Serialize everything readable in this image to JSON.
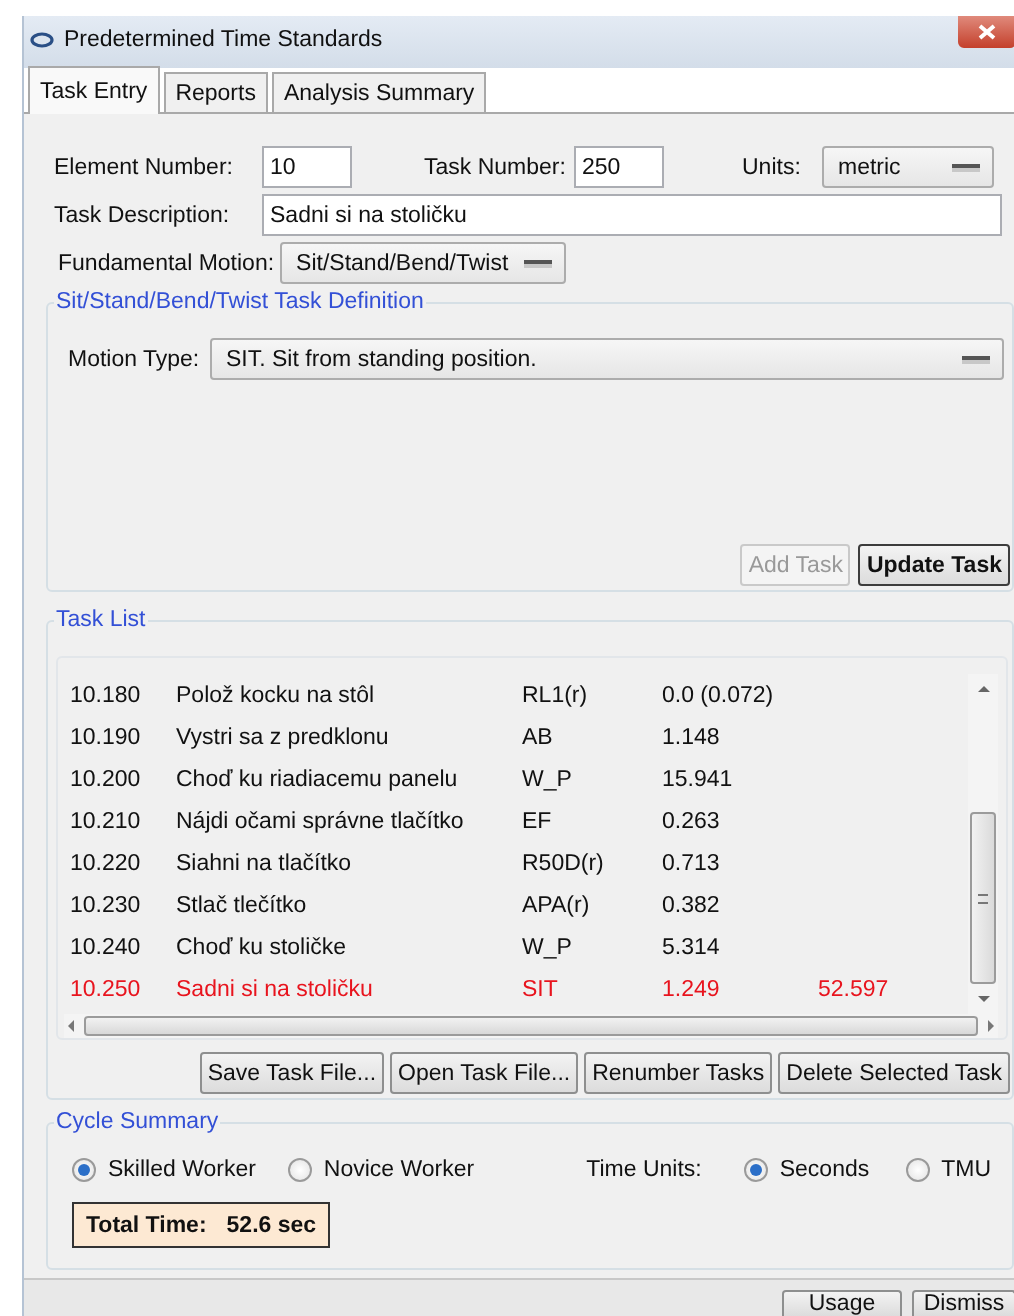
{
  "window": {
    "title": "Predetermined Time Standards"
  },
  "tabs": [
    {
      "label": "Task Entry",
      "selected": true
    },
    {
      "label": "Reports",
      "selected": false
    },
    {
      "label": "Analysis Summary",
      "selected": false
    }
  ],
  "task_entry": {
    "element_number": {
      "label": "Element Number:",
      "value": "10"
    },
    "task_number": {
      "label": "Task Number:",
      "value": "250"
    },
    "units": {
      "label": "Units:",
      "value": "metric"
    },
    "task_description": {
      "label": "Task Description:",
      "value": "Sadni si na stoličku"
    },
    "fundamental_motion": {
      "label": "Fundamental Motion:",
      "value": "Sit/Stand/Bend/Twist"
    }
  },
  "task_definition": {
    "title": "Sit/Stand/Bend/Twist Task Definition",
    "motion_type": {
      "label": "Motion Type:",
      "value": "SIT. Sit from standing position."
    },
    "buttons": [
      {
        "label": "Add Task",
        "disabled": true,
        "default": false
      },
      {
        "label": "Update Task",
        "disabled": false,
        "default": true
      }
    ]
  },
  "task_list": {
    "title": "Task List",
    "rows": [
      {
        "number": "10.180",
        "description": "Polož kocku na stôl",
        "code": "RL1(r)",
        "time": "0.0 (0.072)",
        "highlighted": false
      },
      {
        "number": "10.190",
        "description": "Vystri sa z predklonu",
        "code": "AB",
        "time": "1.148",
        "highlighted": false
      },
      {
        "number": "10.200",
        "description": "Choď ku riadiacemu panelu",
        "code": "W_P",
        "time": "15.941",
        "highlighted": false
      },
      {
        "number": "10.210",
        "description": "Nájdi očami správne tlačítko",
        "code": "EF",
        "time": "0.263",
        "highlighted": false
      },
      {
        "number": "10.220",
        "description": "Siahni na tlačítko",
        "code": "R50D(r)",
        "time": "0.713",
        "highlighted": false
      },
      {
        "number": "10.230",
        "description": "Stlač tlečítko",
        "code": "APA(r)",
        "time": "0.382",
        "highlighted": false
      },
      {
        "number": "10.240",
        "description": "Choď ku stoličke",
        "code": "W_P",
        "time": "5.314",
        "highlighted": false
      },
      {
        "number": "10.250",
        "description": "Sadni si na stoličku",
        "code": "SIT",
        "time": "1.249",
        "cumulative": "52.597",
        "highlighted": true
      }
    ],
    "buttons": [
      "Save Task File...",
      "Open Task File...",
      "Renumber Tasks",
      "Delete Selected Task"
    ]
  },
  "cycle_summary": {
    "title": "Cycle Summary",
    "worker": [
      {
        "label": "Skilled Worker",
        "selected": true
      },
      {
        "label": "Novice Worker",
        "selected": false
      }
    ],
    "time_units_label": "Time Units:",
    "time_units": [
      {
        "label": "Seconds",
        "selected": true
      },
      {
        "label": "TMU",
        "selected": false
      }
    ],
    "total_time": {
      "label": "Total Time:",
      "value": "52.6 sec"
    }
  },
  "footer": {
    "buttons": [
      "Usage",
      "Dismiss"
    ]
  }
}
